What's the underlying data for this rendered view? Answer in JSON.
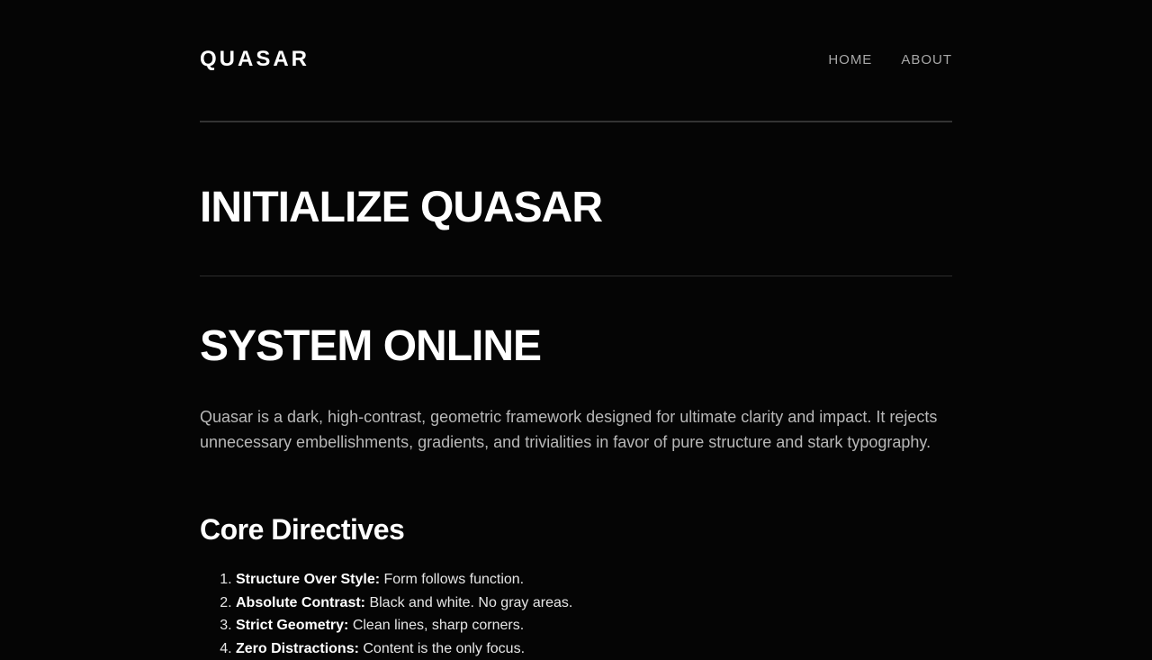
{
  "header": {
    "logo": "QUASAR",
    "nav": [
      {
        "label": "HOME"
      },
      {
        "label": "ABOUT"
      }
    ]
  },
  "hero": {
    "title": "INITIALIZE QUASAR"
  },
  "main": {
    "title": "SYSTEM ONLINE",
    "intro": "Quasar is a dark, high-contrast, geometric framework designed for ultimate clarity and impact. It rejects unnecessary embellishments, gradients, and trivialities in favor of pure structure and stark typography.",
    "directives_title": "Core Directives",
    "directives": [
      {
        "term": "Structure Over Style:",
        "text": " Form follows function."
      },
      {
        "term": "Absolute Contrast:",
        "text": " Black and white. No gray areas."
      },
      {
        "term": "Strict Geometry:",
        "text": " Clean lines, sharp corners."
      },
      {
        "term": "Zero Distractions:",
        "text": " Content is the only focus."
      }
    ]
  },
  "colors": {
    "background": "#050505",
    "text": "#ffffff",
    "muted": "#b8b8b8",
    "nav": "#a8a8a8",
    "rule": "#333333"
  }
}
